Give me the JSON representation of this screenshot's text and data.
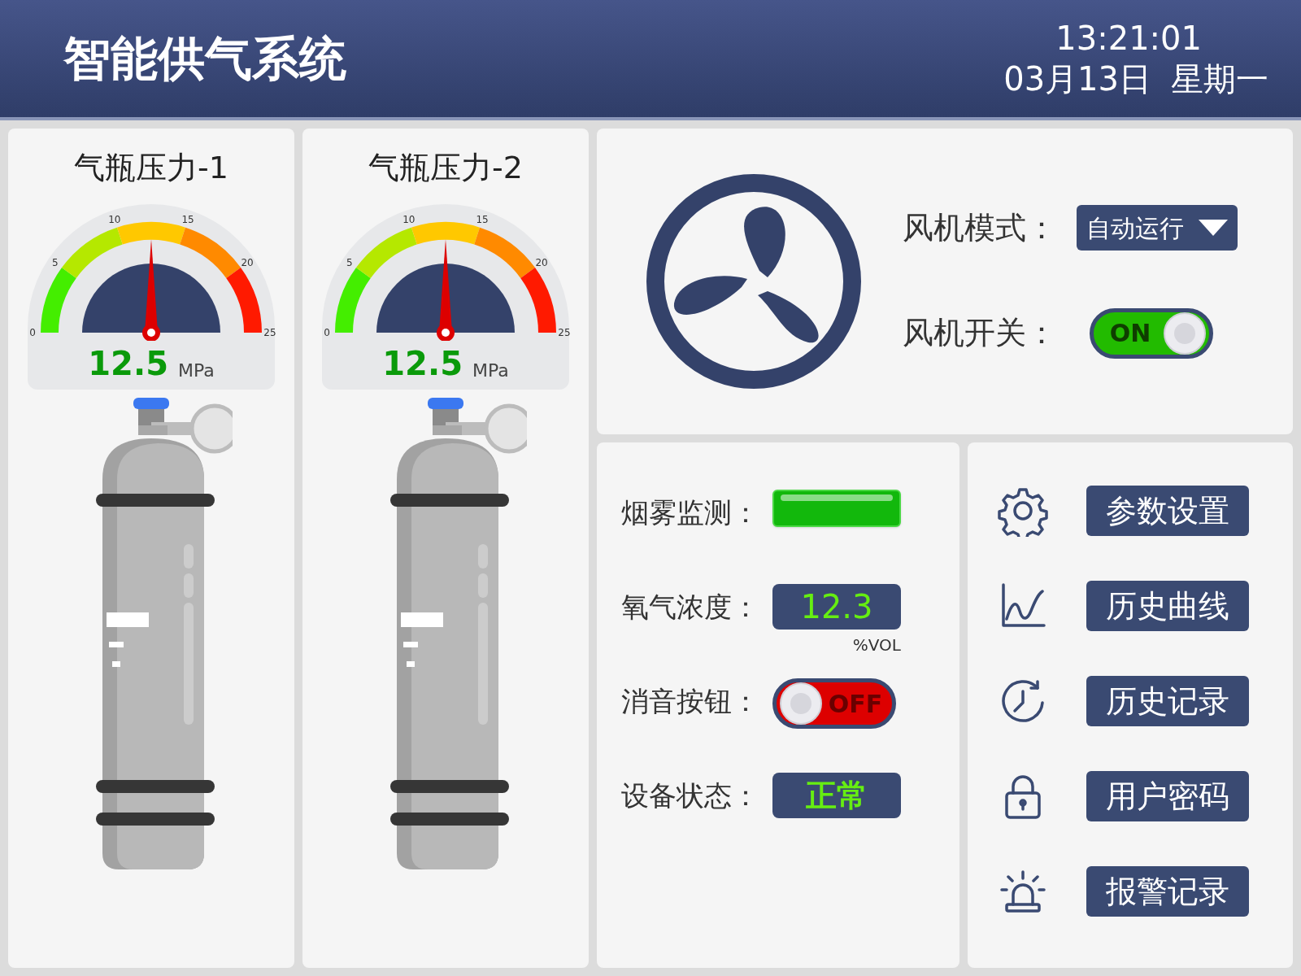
{
  "header": {
    "title": "智能供气系统",
    "time": "13:21:01",
    "date": "03月13日",
    "weekday": "星期一"
  },
  "cylinders": [
    {
      "title": "气瓶压力-1",
      "value": "12.5",
      "unit": "MPa",
      "level": 0.5,
      "scale": [
        "0",
        "5",
        "10",
        "15",
        "20",
        "25"
      ]
    },
    {
      "title": "气瓶压力-2",
      "value": "12.5",
      "unit": "MPa",
      "level": 0.5,
      "scale": [
        "0",
        "5",
        "10",
        "15",
        "20",
        "25"
      ]
    }
  ],
  "fan": {
    "mode_label": "风机模式：",
    "mode": "自动运行",
    "switch_label": "风机开关：",
    "switch_on": true,
    "switch_text": "ON"
  },
  "monitors": [
    {
      "kind": "indicator",
      "label": "烟雾监测：",
      "alarm": false
    },
    {
      "kind": "reading",
      "label": "氧气浓度：",
      "value": "12.3",
      "unit": "%VOL"
    },
    {
      "kind": "switch",
      "label": "消音按钮：",
      "on": false,
      "text": "OFF"
    },
    {
      "kind": "status",
      "label": "设备状态：",
      "value": "正常"
    }
  ],
  "menu": [
    {
      "kind": "gear",
      "label": "参数设置"
    },
    {
      "kind": "chart",
      "label": "历史曲线"
    },
    {
      "kind": "clock",
      "label": "历史记录"
    },
    {
      "kind": "lock",
      "label": "用户密码"
    },
    {
      "kind": "alarm",
      "label": "报警记录"
    }
  ]
}
